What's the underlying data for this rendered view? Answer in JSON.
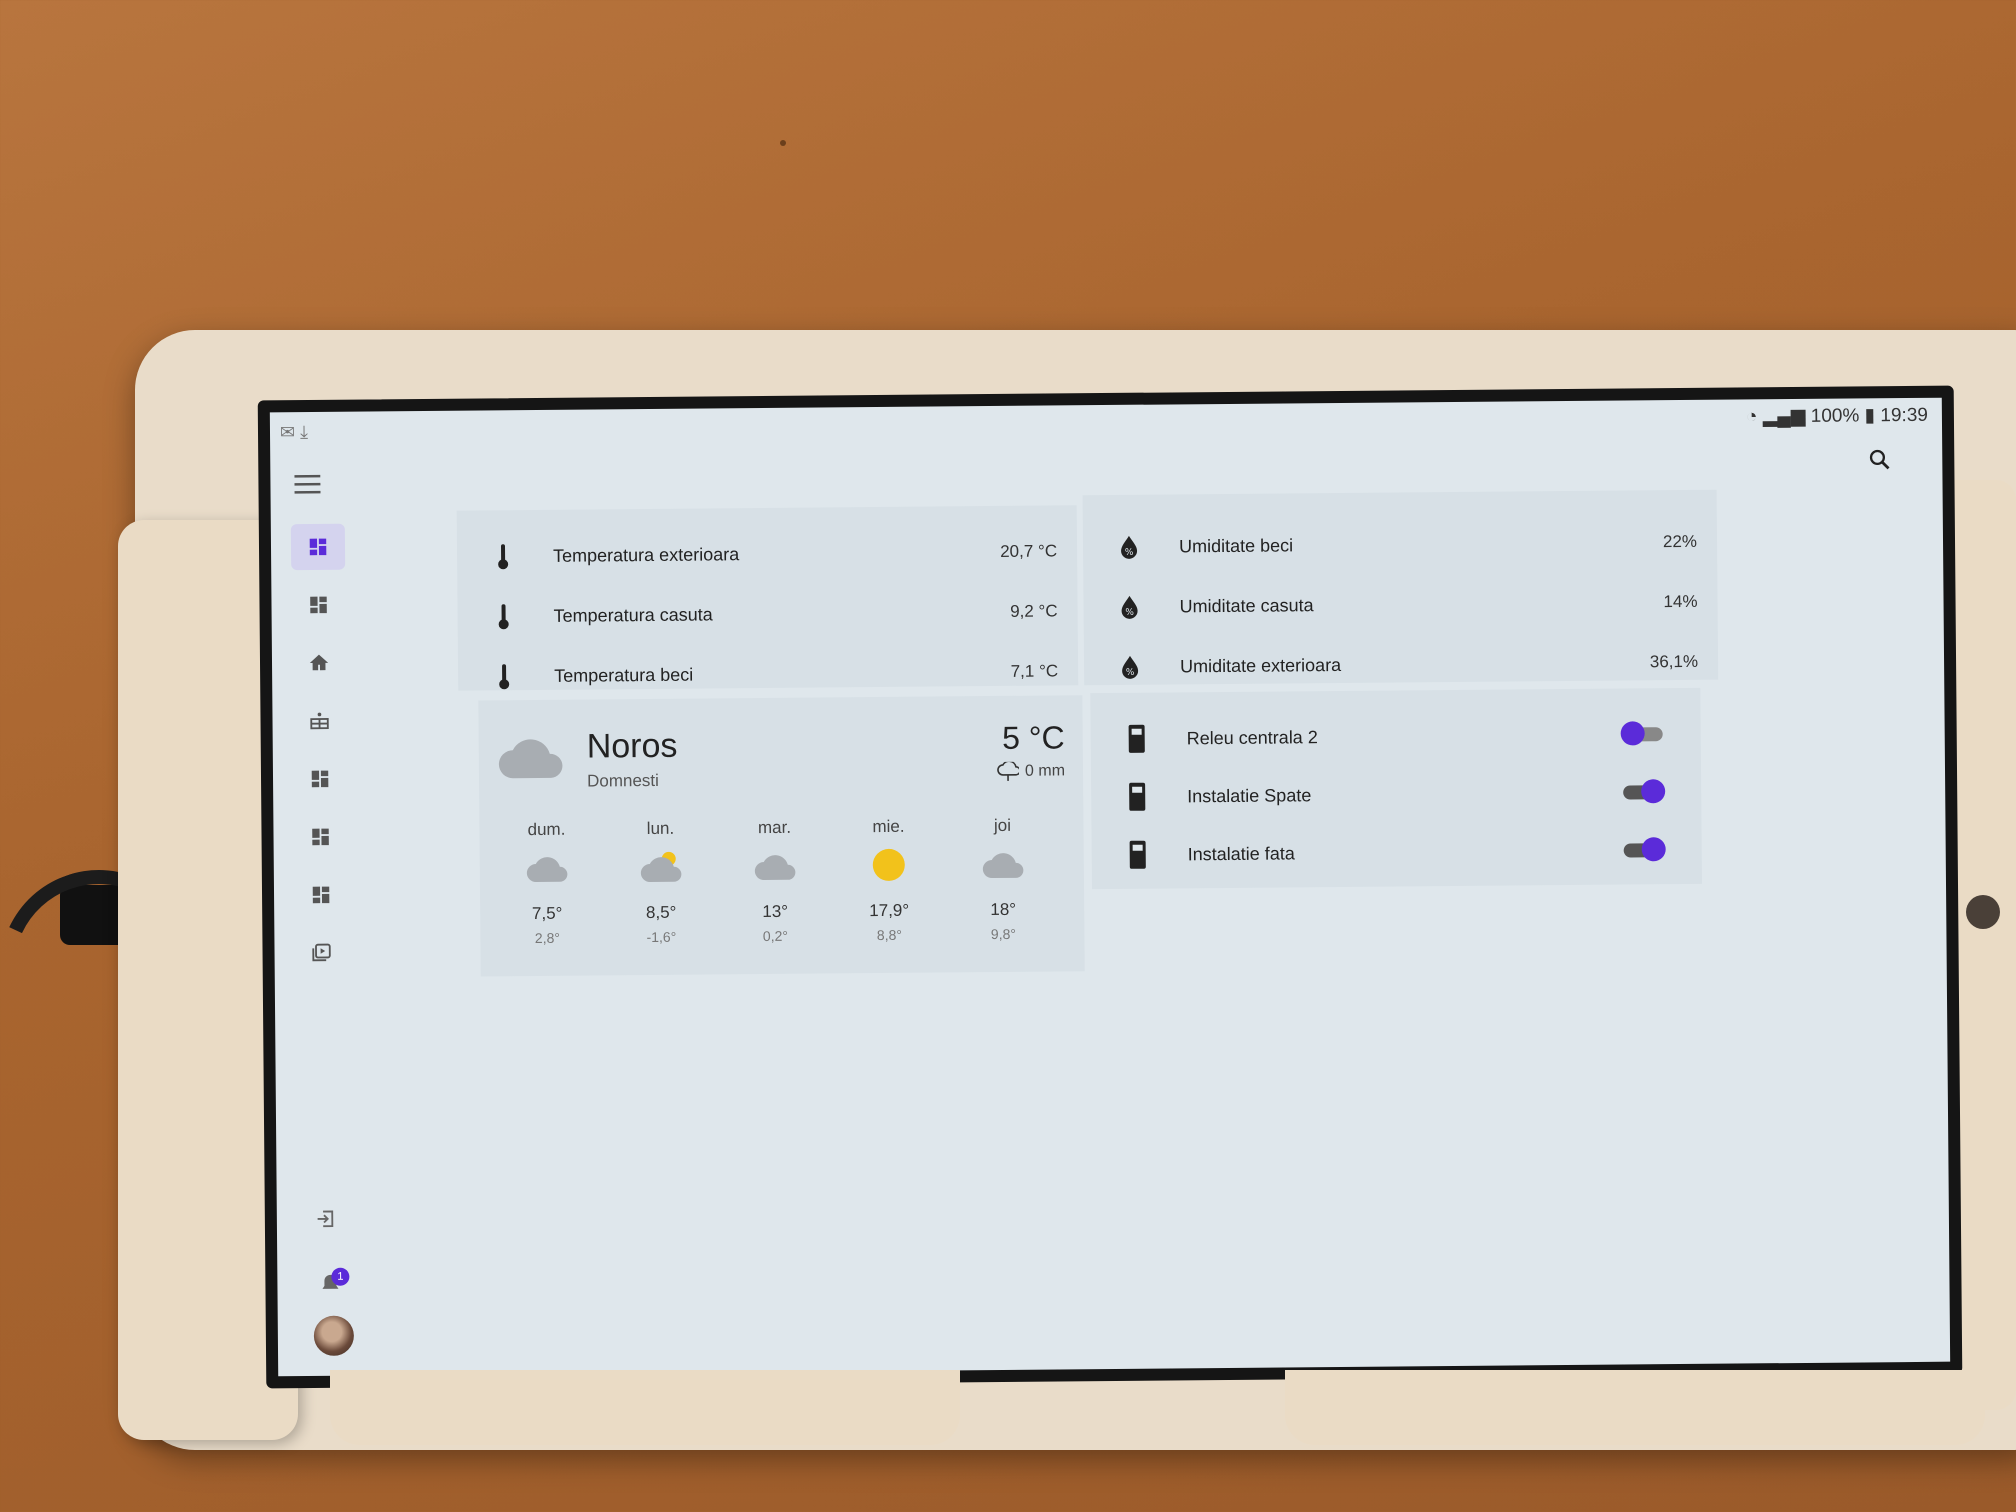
{
  "colors": {
    "accent": "#5b2bd9",
    "active_bg": "#d4d3ee",
    "sun": "#f2c21b",
    "card_bg": "#d7e0e6"
  },
  "status_bar": {
    "battery": "100%",
    "time": "19:39"
  },
  "sidebar": {
    "items": [
      {
        "icon": "dashboard-icon",
        "active": true
      },
      {
        "icon": "dashboard-icon",
        "active": false
      },
      {
        "icon": "home-icon",
        "active": false
      },
      {
        "icon": "solar-panel-icon",
        "active": false
      },
      {
        "icon": "dashboard-icon",
        "active": false
      },
      {
        "icon": "dashboard-icon",
        "active": false
      },
      {
        "icon": "dashboard-icon",
        "active": false
      },
      {
        "icon": "media-icon",
        "active": false
      }
    ],
    "notifications_badge": "1"
  },
  "temperatures": [
    {
      "label": "Temperatura exterioara",
      "value": "20,7 °C"
    },
    {
      "label": "Temperatura casuta",
      "value": "9,2 °C"
    },
    {
      "label": "Temperatura beci",
      "value": "7,1 °C"
    }
  ],
  "humidity": [
    {
      "label": "Umiditate beci",
      "value": "22%"
    },
    {
      "label": "Umiditate casuta",
      "value": "14%"
    },
    {
      "label": "Umiditate exterioara",
      "value": "36,1%"
    }
  ],
  "weather": {
    "condition": "Noros",
    "location": "Domnesti",
    "temperature": "5 °C",
    "precipitation": "0 mm",
    "forecast": [
      {
        "day": "dum.",
        "icon": "cloudy-icon",
        "high": "7,5°",
        "low": "2,8°"
      },
      {
        "day": "lun.",
        "icon": "partly-cloudy-icon",
        "high": "8,5°",
        "low": "-1,6°"
      },
      {
        "day": "mar.",
        "icon": "cloudy-icon",
        "high": "13°",
        "low": "0,2°"
      },
      {
        "day": "mie.",
        "icon": "sunny-icon",
        "high": "17,9°",
        "low": "8,8°"
      },
      {
        "day": "joi",
        "icon": "cloudy-icon",
        "high": "18°",
        "low": "9,8°"
      }
    ]
  },
  "switches": [
    {
      "label": "Releu centrala 2",
      "on": false
    },
    {
      "label": "Instalatie Spate",
      "on": true
    },
    {
      "label": "Instalatie fata",
      "on": true
    }
  ]
}
